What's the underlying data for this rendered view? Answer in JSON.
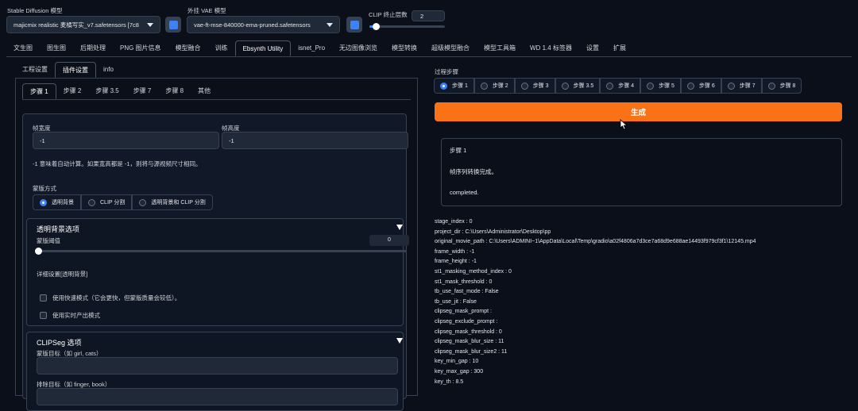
{
  "header": {
    "sd_model_label": "Stable Diffusion 模型",
    "sd_model_value": "majicmix realistic 麦橘写实_v7.safetensors [7c8",
    "vae_label": "外挂 VAE 模型",
    "vae_value": "vae-ft-mse-840000-ema-pruned.safetensors",
    "clip_label": "CLIP 终止层数",
    "clip_value": "2",
    "clip_level": 0.08
  },
  "main_tabs": [
    "文生图",
    "图生图",
    "后期处理",
    "PNG 图片信息",
    "模型融合",
    "训练",
    "Ebsynth Utility",
    "isnet_Pro",
    "无边图像浏览",
    "模型转换",
    "超级模型融合",
    "模型工具箱",
    "WD 1.4 标签器",
    "设置",
    "扩展"
  ],
  "active_main_tab": 6,
  "sub_tabs": [
    "工程设置",
    "插件设置",
    "info"
  ],
  "active_sub_tab": 1,
  "step_tabs": [
    "步骤 1",
    "步骤 2",
    "步骤 3.5",
    "步骤 7",
    "步骤 8",
    "其他"
  ],
  "active_step_tab": 0,
  "frame_width": {
    "label": "帧宽度",
    "value": "-1"
  },
  "frame_height": {
    "label": "帧高度",
    "value": "-1"
  },
  "hint": "-1 意味着自动计算。如果宽高都是 -1，则将与源视频尺寸相同。",
  "mask_method": {
    "label": "蒙版方式",
    "options": [
      "透明背景",
      "CLIP 分割",
      "透明背景和 CLIP 分割"
    ],
    "selected": 0
  },
  "transparent_bg": {
    "title": "透明背景选项",
    "threshold_label": "蒙版阈值",
    "threshold_value": "0",
    "detail_label": "详细设置[透明背景]",
    "fast_mode": "使用快速模式（它会更快，但蒙版质量会较低）。",
    "jit": "使用实时产出模式"
  },
  "clipseg": {
    "title": "CLIPSeg 选项",
    "target_label": "蒙版目标（如 girl, cats）",
    "exclude_label": "排除目标（如 finger, book）"
  },
  "process": {
    "label": "过程步骤",
    "steps": [
      "步骤 1",
      "步骤 2",
      "步骤 3",
      "步骤 3.5",
      "步骤 4",
      "步骤 5",
      "步骤 6",
      "步骤 7",
      "步骤 8"
    ],
    "selected": 0,
    "generate": "生成"
  },
  "output": {
    "line1": "步骤 1",
    "line2": "帧序列转换完成。",
    "line3": "completed."
  },
  "info_lines": [
    "stage_index : 0",
    "project_dir : C:\\Users\\Administrator\\Desktop\\pp",
    "original_movie_path : C:\\Users\\ADMINI~1\\AppData\\Local\\Temp\\gradio\\a02f4806a7d3ce7a68d9e688ae14493f979cf3f1\\12145.mp4",
    "frame_width : -1",
    "frame_height : -1",
    "st1_masking_method_index : 0",
    "st1_mask_threshold : 0",
    "tb_use_fast_mode : False",
    "tb_use_jit : False",
    "clipseg_mask_prompt :",
    "clipseg_exclude_prompt :",
    "clipseg_mask_threshold : 0",
    "clipseg_mask_blur_size : 11",
    "clipseg_mask_blur_size2 : 11",
    "key_min_gap : 10",
    "key_max_gap : 300",
    "key_th : 8.5"
  ],
  "colors": {
    "accent": "#f97316",
    "radio": "#3b82f6"
  },
  "icons": {
    "refresh": "refresh-icon",
    "collapse": "triangle-down-icon",
    "cursor": "mouse-pointer-icon"
  }
}
